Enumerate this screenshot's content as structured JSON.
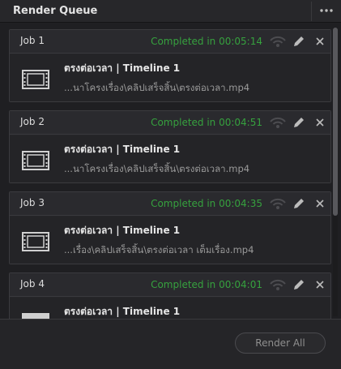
{
  "panel": {
    "title": "Render Queue"
  },
  "jobs": [
    {
      "name": "Job 1",
      "status": "Completed in 00:05:14",
      "title": "ตรงต่อเวลา | Timeline 1",
      "path": "...นาโครงเรื่อง\\คลิปเสร็จสิ้น\\ตรงต่อเวลา.mp4"
    },
    {
      "name": "Job 2",
      "status": "Completed in 00:04:51",
      "title": "ตรงต่อเวลา | Timeline 1",
      "path": "...นาโครงเรื่อง\\คลิปเสร็จสิ้น\\ตรงต่อเวลา.mp4"
    },
    {
      "name": "Job 3",
      "status": "Completed in 00:04:35",
      "title": "ตรงต่อเวลา | Timeline 1",
      "path": "...เรื่อง\\คลิปเสร็จสิ้น\\ตรงต่อเวลา เต็มเรื่อง.mp4"
    },
    {
      "name": "Job 4",
      "status": "Completed in 00:04:01",
      "title": "ตรงต่อเวลา | Timeline 1",
      "path": ""
    }
  ],
  "footer": {
    "render_all_label": "Render All"
  },
  "colors": {
    "status": "#36a13e",
    "background": "#1f1f22",
    "card": "#262629"
  },
  "icons": {
    "more": "more-options-icon",
    "remote": "remote-render-icon",
    "edit": "pencil-icon",
    "close": "close-icon",
    "thumbnail": "film-strip-icon"
  }
}
